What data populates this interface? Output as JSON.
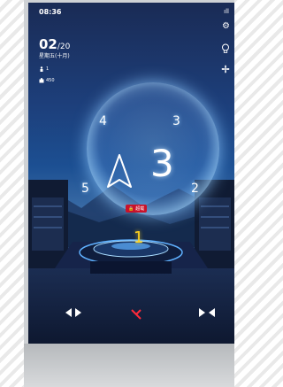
{
  "status_bar": {
    "time": "08:36",
    "signal": "ıll"
  },
  "date": {
    "day": "02",
    "month": "/20",
    "sub": "星期五(十月)"
  },
  "stats": [
    {
      "icon": "passenger-icon",
      "value": "1"
    },
    {
      "icon": "load-icon",
      "value": "450"
    }
  ],
  "side_icons": [
    "gear-icon",
    "bulb-icon",
    "fan-icon"
  ],
  "floors": {
    "f1": "1",
    "f2": "2",
    "f3": "3",
    "f4": "4",
    "f5": "5"
  },
  "current_floor": "3",
  "direction": "up",
  "alert": {
    "text": "超载",
    "color": "#c9122a"
  },
  "colors": {
    "accent": "#ffd21e",
    "glow": "#8cc8ff"
  }
}
